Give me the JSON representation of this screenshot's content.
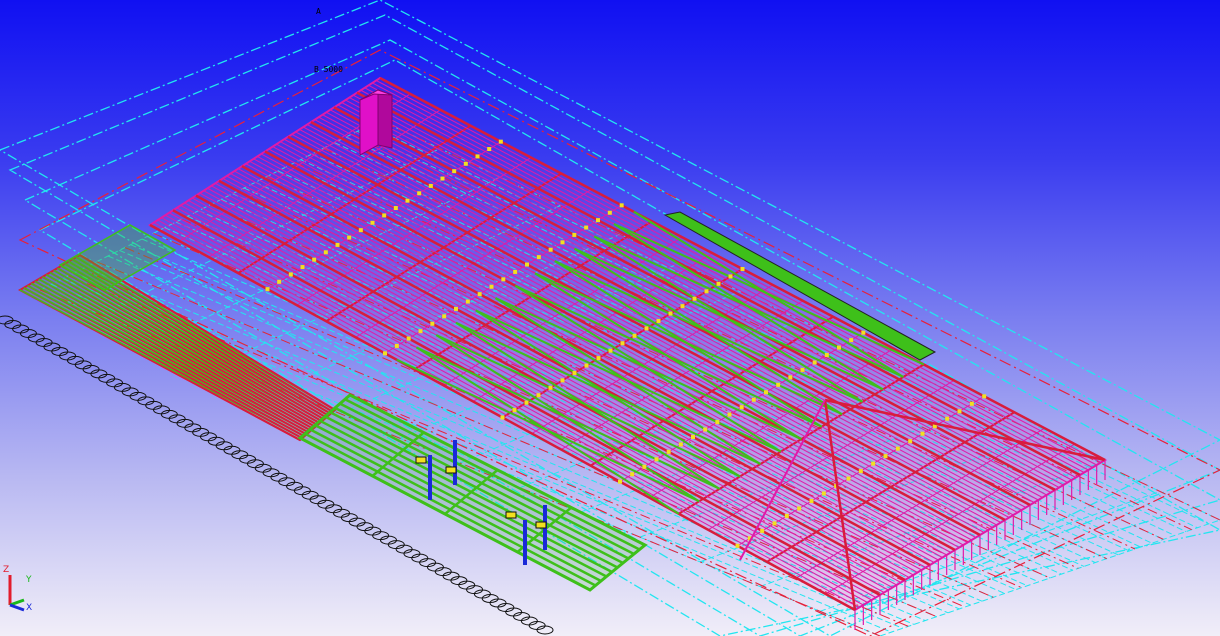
{
  "window": {
    "title": ""
  },
  "viewport": {
    "background_top": "#1010f2",
    "background_bottom": "#f1eef8",
    "colors": {
      "gridline_cyan": "#22e6f0",
      "gridline_red": "#e8203a",
      "member_magenta": "#e01aa8",
      "member_red": "#d81c3c",
      "member_green": "#3ec01a",
      "member_yellow": "#f2e020",
      "column_blue": "#1a2ad8"
    },
    "labels": {
      "label_top": "A",
      "label_left": "B 5000"
    }
  },
  "axis_triad": {
    "x": "X",
    "y": "Y",
    "z": "Z"
  }
}
